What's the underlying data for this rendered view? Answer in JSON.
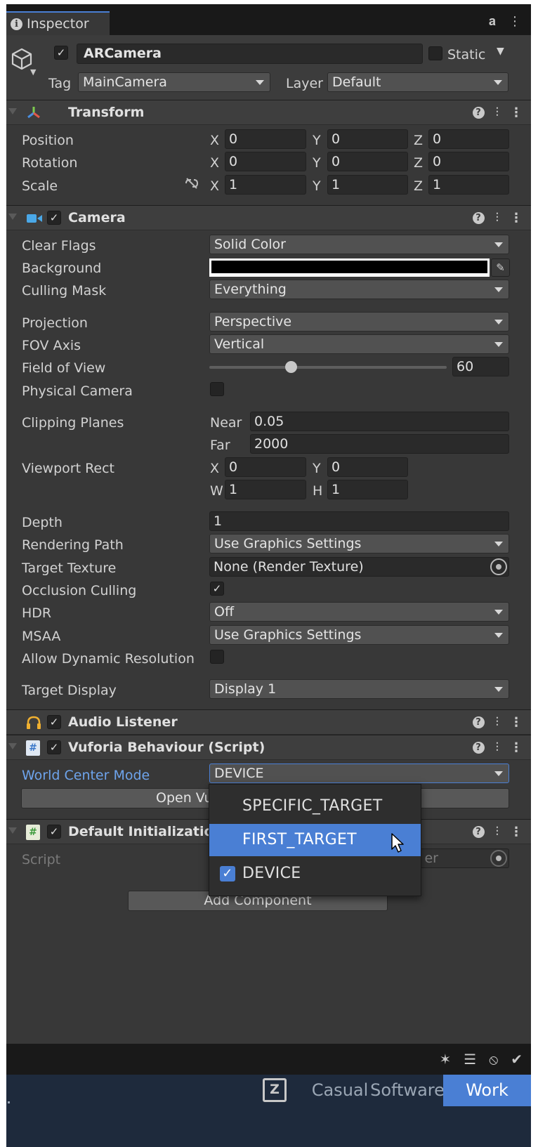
{
  "tab": {
    "title": "Inspector"
  },
  "gameobject": {
    "name": "ARCamera",
    "static_label": "Static",
    "tag_label": "Tag",
    "tag_value": "MainCamera",
    "layer_label": "Layer",
    "layer_value": "Default"
  },
  "transform": {
    "title": "Transform",
    "rows": [
      {
        "label": "Position",
        "x": "0",
        "y": "0",
        "z": "0"
      },
      {
        "label": "Rotation",
        "x": "0",
        "y": "0",
        "z": "0"
      },
      {
        "label": "Scale",
        "x": "1",
        "y": "1",
        "z": "1"
      }
    ],
    "axis": {
      "x": "X",
      "y": "Y",
      "z": "Z"
    }
  },
  "camera": {
    "title": "Camera",
    "clear_flags_label": "Clear Flags",
    "clear_flags_value": "Solid Color",
    "background_label": "Background",
    "background_color": "#000000",
    "culling_mask_label": "Culling Mask",
    "culling_mask_value": "Everything",
    "projection_label": "Projection",
    "projection_value": "Perspective",
    "fov_axis_label": "FOV Axis",
    "fov_axis_value": "Vertical",
    "fov_label": "Field of View",
    "fov_value": "60",
    "physical_camera_label": "Physical Camera",
    "clipping_label": "Clipping Planes",
    "near_label": "Near",
    "near_value": "0.05",
    "far_label": "Far",
    "far_value": "2000",
    "viewport_label": "Viewport Rect",
    "viewport": {
      "x_label": "X",
      "x": "0",
      "y_label": "Y",
      "y": "0",
      "w_label": "W",
      "w": "1",
      "h_label": "H",
      "h": "1"
    },
    "depth_label": "Depth",
    "depth_value": "1",
    "rendering_path_label": "Rendering Path",
    "rendering_path_value": "Use Graphics Settings",
    "target_texture_label": "Target Texture",
    "target_texture_value": "None (Render Texture)",
    "occlusion_label": "Occlusion Culling",
    "hdr_label": "HDR",
    "hdr_value": "Off",
    "msaa_label": "MSAA",
    "msaa_value": "Use Graphics Settings",
    "dynamic_res_label": "Allow Dynamic Resolution",
    "target_display_label": "Target Display",
    "target_display_value": "Display 1"
  },
  "audio_listener": {
    "title": "Audio Listener"
  },
  "vuforia": {
    "title": "Vuforia Behaviour (Script)",
    "world_center_label": "World Center Mode",
    "world_center_value": "DEVICE",
    "open_button_label": "Open Vu"
  },
  "default_init": {
    "title": "Default Initialization E",
    "script_label": "Script",
    "script_value_tail": "er"
  },
  "popup": {
    "options": [
      "SPECIFIC_TARGET",
      "FIRST_TARGET",
      "DEVICE"
    ],
    "highlighted": "FIRST_TARGET",
    "checked": "DEVICE"
  },
  "add_component_label": "Add Component",
  "taskbar": {
    "logo": "Z",
    "items": [
      "Casual",
      "Software",
      "Work"
    ],
    "active": "Work"
  },
  "colors": {
    "accent": "#4a7fd4",
    "panel": "#383838",
    "field": "#2a2a2a"
  }
}
